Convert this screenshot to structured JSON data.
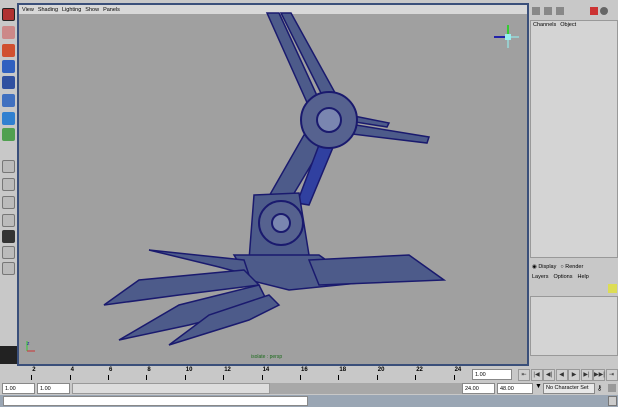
{
  "viewport": {
    "menu": [
      "View",
      "Shading",
      "Lighting",
      "Show",
      "Panels"
    ],
    "camera_label": "isolate : persp",
    "axis_label": "z"
  },
  "channel_box": {
    "tabs": [
      "Channels",
      "Object"
    ]
  },
  "layer_editor": {
    "display": "Display",
    "render": "Render",
    "menu": [
      "Layers",
      "Options",
      "Help"
    ]
  },
  "timeline": {
    "ticks": [
      "2",
      "4",
      "6",
      "8",
      "10",
      "12",
      "14",
      "16",
      "18",
      "20",
      "22",
      "24"
    ],
    "current_frame": "1.00"
  },
  "range": {
    "start": "1.00",
    "playback_start": "1.00",
    "playback_end": "24.00",
    "end": "48.00",
    "character_set": "No Character Set"
  },
  "playback": [
    "⇤",
    "|◀",
    "◀|",
    "◀",
    "▶",
    "▶|",
    "▶▶|",
    "⇥"
  ],
  "colors": {
    "wire": "#1a1a6e",
    "viewport_bg": "#a0a0a0",
    "border": "#3a4f7a"
  }
}
